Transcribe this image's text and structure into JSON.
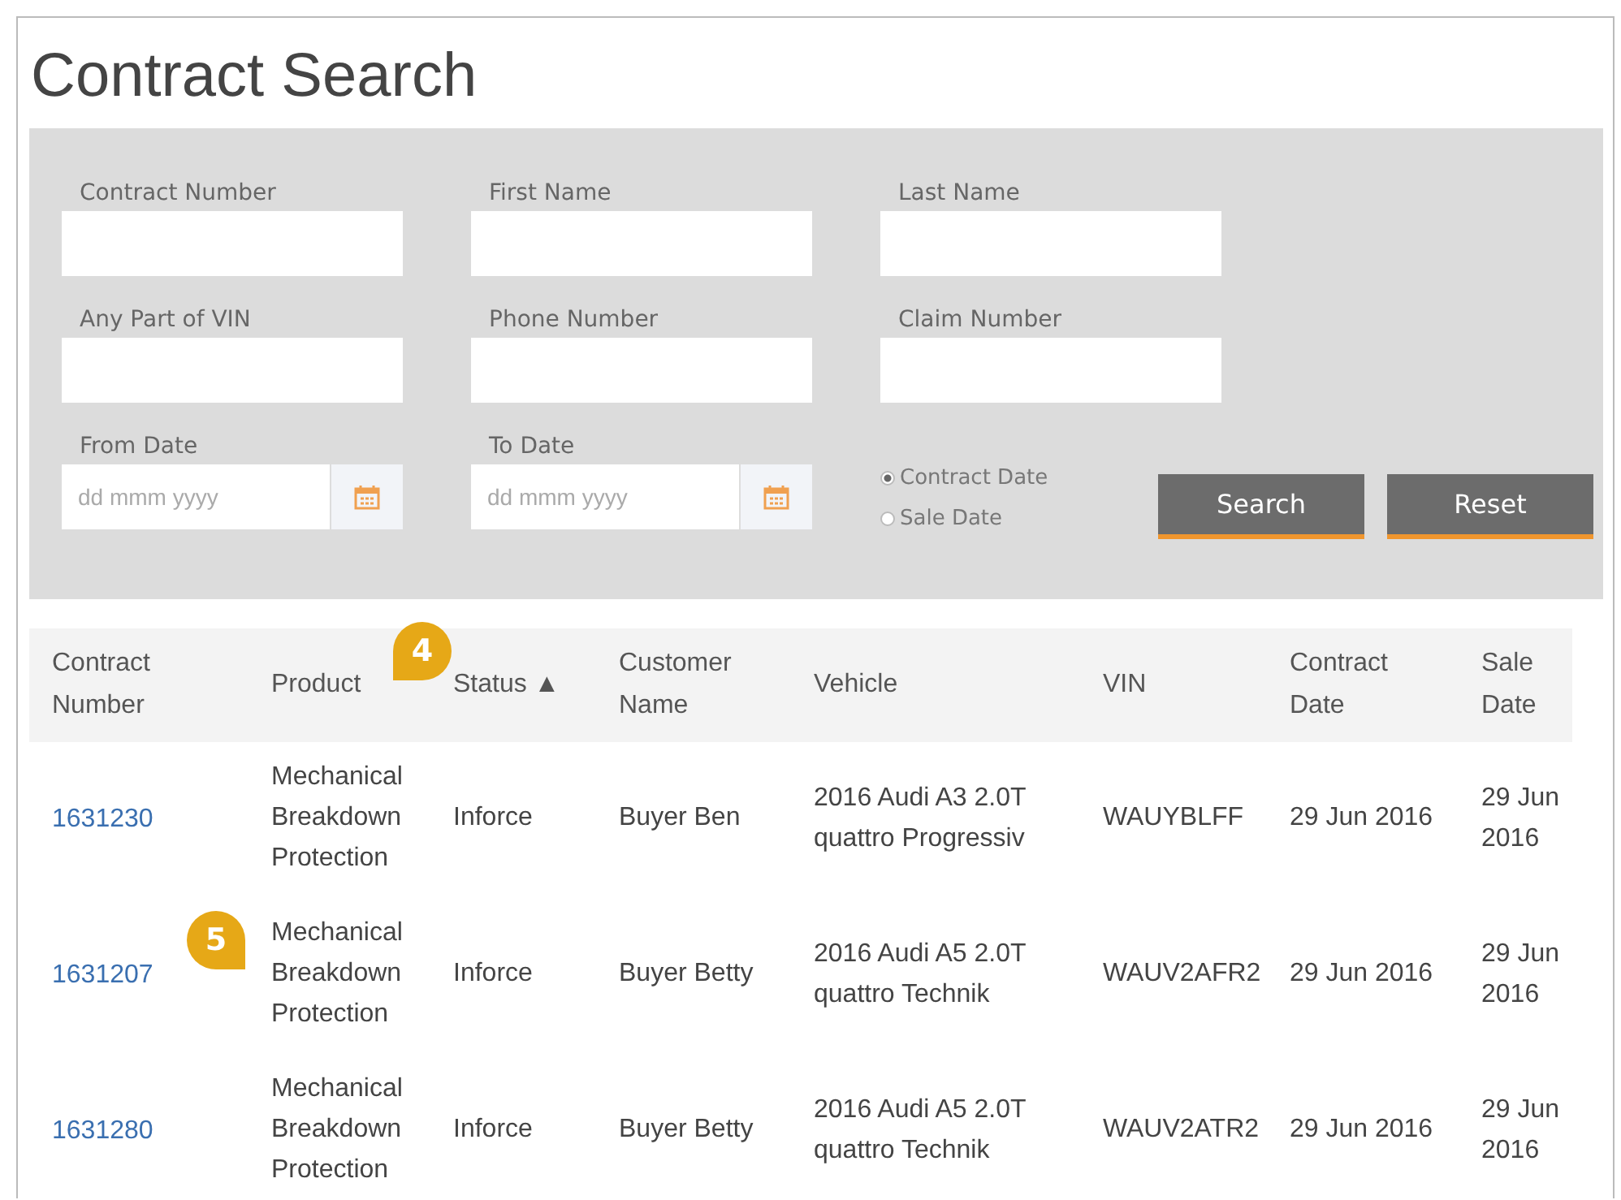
{
  "title": "Contract Search",
  "form": {
    "fields": [
      {
        "label": "Contract Number",
        "kind": "text"
      },
      {
        "label": "First Name",
        "kind": "text"
      },
      {
        "label": "Last Name",
        "kind": "text"
      },
      {
        "label": "Any Part of VIN",
        "kind": "text"
      },
      {
        "label": "Phone Number",
        "kind": "text"
      },
      {
        "label": "Claim Number",
        "kind": "text"
      },
      {
        "label": "From Date",
        "kind": "date",
        "placeholder": "dd mmm yyyy"
      },
      {
        "label": "To Date",
        "kind": "date",
        "placeholder": "dd mmm yyyy"
      }
    ],
    "date_type": [
      {
        "label": "Contract Date",
        "selected": true
      },
      {
        "label": "Sale Date",
        "selected": false
      }
    ],
    "buttons": [
      "Search",
      "Reset"
    ]
  },
  "table": {
    "columns": [
      "Contract Number",
      "Product",
      "Status ▲",
      "Customer Name",
      "Vehicle",
      "VIN",
      "Contract Date",
      "Sale Date"
    ],
    "rows": [
      [
        "1631230",
        "Mechanical Breakdown Protection",
        "Inforce",
        "Buyer Ben",
        "2016 Audi A3 2.0T quattro Progressiv",
        "WAUYBLFF",
        "29 Jun 2016",
        "29 Jun 2016"
      ],
      [
        "1631207",
        "Mechanical Breakdown Protection",
        "Inforce",
        "Buyer Betty",
        "2016 Audi A5 2.0T quattro Technik",
        "WAUV2AFR2",
        "29 Jun 2016",
        "29 Jun 2016"
      ],
      [
        "1631280",
        "Mechanical Breakdown Protection",
        "Inforce",
        "Buyer Betty",
        "2016 Audi A5 2.0T quattro Technik",
        "WAUV2ATR2",
        "29 Jun 2016",
        "29 Jun 2016"
      ]
    ]
  },
  "callouts": [
    {
      "label": "4"
    },
    {
      "label": "5"
    }
  ]
}
